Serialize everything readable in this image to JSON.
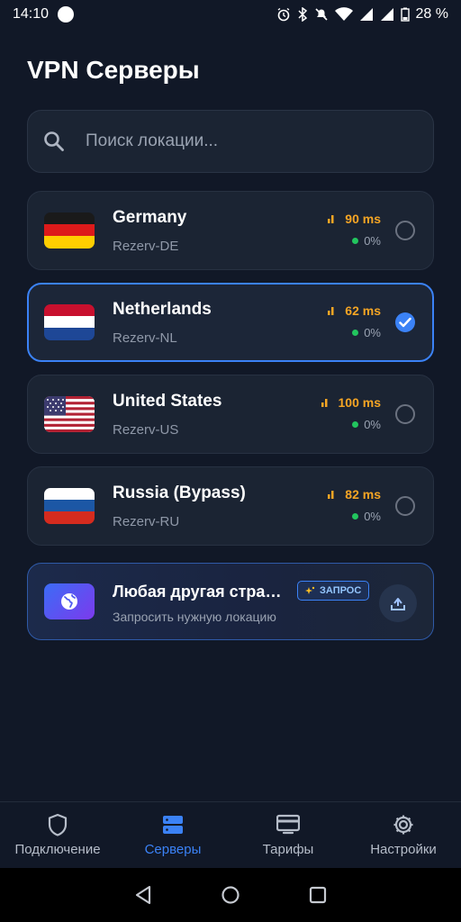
{
  "status_bar": {
    "time": "14:10",
    "battery": "28 %",
    "icons": [
      "alarm-icon",
      "bluetooth-icon",
      "mute-icon",
      "wifi-icon",
      "signal-icon",
      "signal-r-icon",
      "battery-icon"
    ]
  },
  "page": {
    "title": "VPN Серверы"
  },
  "search": {
    "placeholder": "Поиск локации...",
    "icon": "search-icon"
  },
  "servers": [
    {
      "name": "Germany",
      "subtitle": "Rezerv-DE",
      "ping": "90 ms",
      "load": "0%",
      "flag": "germany",
      "selected": false
    },
    {
      "name": "Netherlands",
      "subtitle": "Rezerv-NL",
      "ping": "62 ms",
      "load": "0%",
      "flag": "netherlands",
      "selected": true
    },
    {
      "name": "United States",
      "subtitle": "Rezerv-US",
      "ping": "100 ms",
      "load": "0%",
      "flag": "usa",
      "selected": false
    },
    {
      "name": "Russia (Bypass)",
      "subtitle": "Rezerv-RU",
      "ping": "82 ms",
      "load": "0%",
      "flag": "russia",
      "selected": false
    }
  ],
  "request": {
    "title": "Любая другая страна",
    "subtitle": "Запросить нужную локацию",
    "badge": "ЗАПРОС",
    "icon": "globe-icon",
    "action_icon": "upload-icon"
  },
  "nav": {
    "items": [
      {
        "label": "Подключение",
        "icon": "shield-icon",
        "active": false
      },
      {
        "label": "Серверы",
        "icon": "server-icon",
        "active": true
      },
      {
        "label": "Тарифы",
        "icon": "pricing-icon",
        "active": false
      },
      {
        "label": "Настройки",
        "icon": "gear-icon",
        "active": false
      }
    ]
  },
  "colors": {
    "background": "#111827",
    "card": "#1b2433",
    "accent": "#3b82f6",
    "ping": "#f5a524",
    "load_dot": "#22c55e"
  }
}
